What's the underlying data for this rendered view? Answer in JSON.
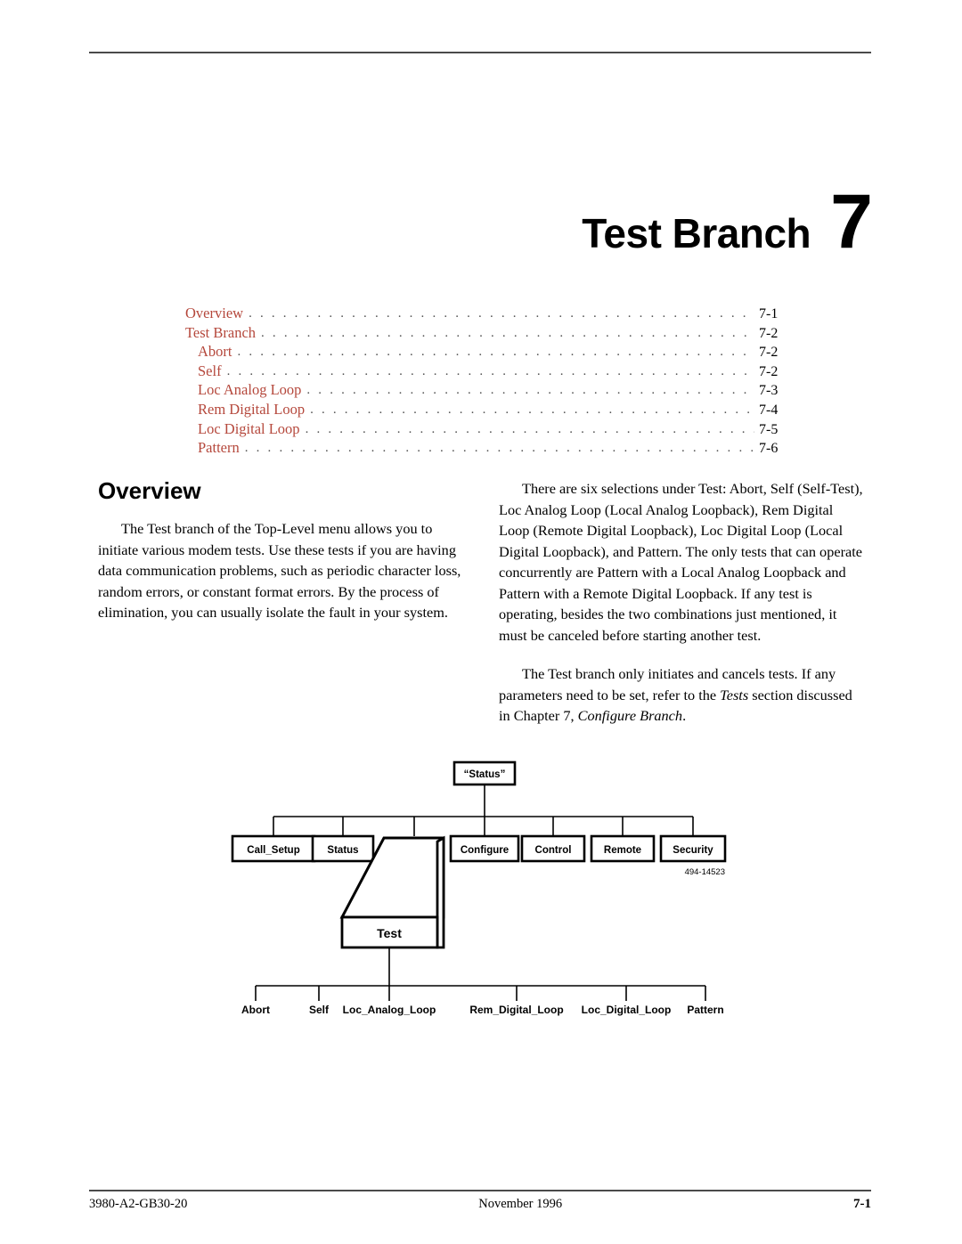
{
  "header": {
    "rule": "horizontal-rule"
  },
  "chapter": {
    "title": "Test Branch",
    "number": "7"
  },
  "toc": {
    "entries": [
      {
        "label": "Overview",
        "page": "7-1",
        "indent": false
      },
      {
        "label": "Test Branch",
        "page": "7-2",
        "indent": false
      },
      {
        "label": "Abort",
        "page": "7-2",
        "indent": true
      },
      {
        "label": "Self",
        "page": "7-2",
        "indent": true
      },
      {
        "label": "Loc Analog Loop",
        "page": "7-3",
        "indent": true
      },
      {
        "label": "Rem Digital Loop",
        "page": "7-4",
        "indent": true
      },
      {
        "label": "Loc Digital Loop",
        "page": "7-5",
        "indent": true
      },
      {
        "label": "Pattern",
        "page": "7-6",
        "indent": true
      }
    ],
    "leader": ". . . . . . . . . . . . . . . . . . . . . . . . . . . . . . . . . . . . . . . . . . . . . . . . . . . . . . . . . . . . . . . . . . . . . . . . . . . . . . . . . . . . . . . . . . . . . . . . . . . . . . . . . . . . . . . . . . . . . . . . . .",
    "text_color": "#b5483c",
    "page_color": "#000000"
  },
  "main": {
    "section_heading": "Overview",
    "left_column": {
      "paragraph_1": "The Test branch of the Top-Level menu allows you to initiate various modem tests. Use these tests if you are having data communication problems, such as periodic character loss, random errors, or constant format errors. By the process of elimination, you can usually isolate the fault in your system."
    },
    "right_column": {
      "paragraph_1": "There are six selections under Test: Abort, Self (Self-Test), Loc Analog Loop (Local Analog Loopback), Rem Digital Loop (Remote Digital Loopback), Loc Digital Loop (Local Digital Loopback), and Pattern. The only tests that can operate concurrently are Pattern with a Local Analog Loopback and Pattern with a Remote Digital Loopback. If any test is operating, besides the two combinations just mentioned, it must be canceled before starting another test.",
      "paragraph_2_part_1": "The Test branch only initiates and cancels tests. If any parameters need to be set, refer to the ",
      "paragraph_2_italic_1": "Tests",
      "paragraph_2_part_2": " section discussed in Chapter 7, ",
      "paragraph_2_italic_2": "Configure Branch",
      "paragraph_2_part_3": "."
    }
  },
  "diagram": {
    "root": "“Status”",
    "level1": [
      "Call_Setup",
      "Status",
      "Test",
      "Configure",
      "Control",
      "Remote",
      "Security"
    ],
    "highlighted_node": "Test",
    "leaves": [
      "Abort",
      "Self",
      "Loc_Analog_Loop",
      "Rem_Digital_Loop",
      "Loc_Digital_Loop",
      "Pattern"
    ],
    "reference_number": "494-14523"
  },
  "footer": {
    "document_number": "3980-A2-GB30-20",
    "date": "November 1996",
    "page_number": "7-1"
  }
}
